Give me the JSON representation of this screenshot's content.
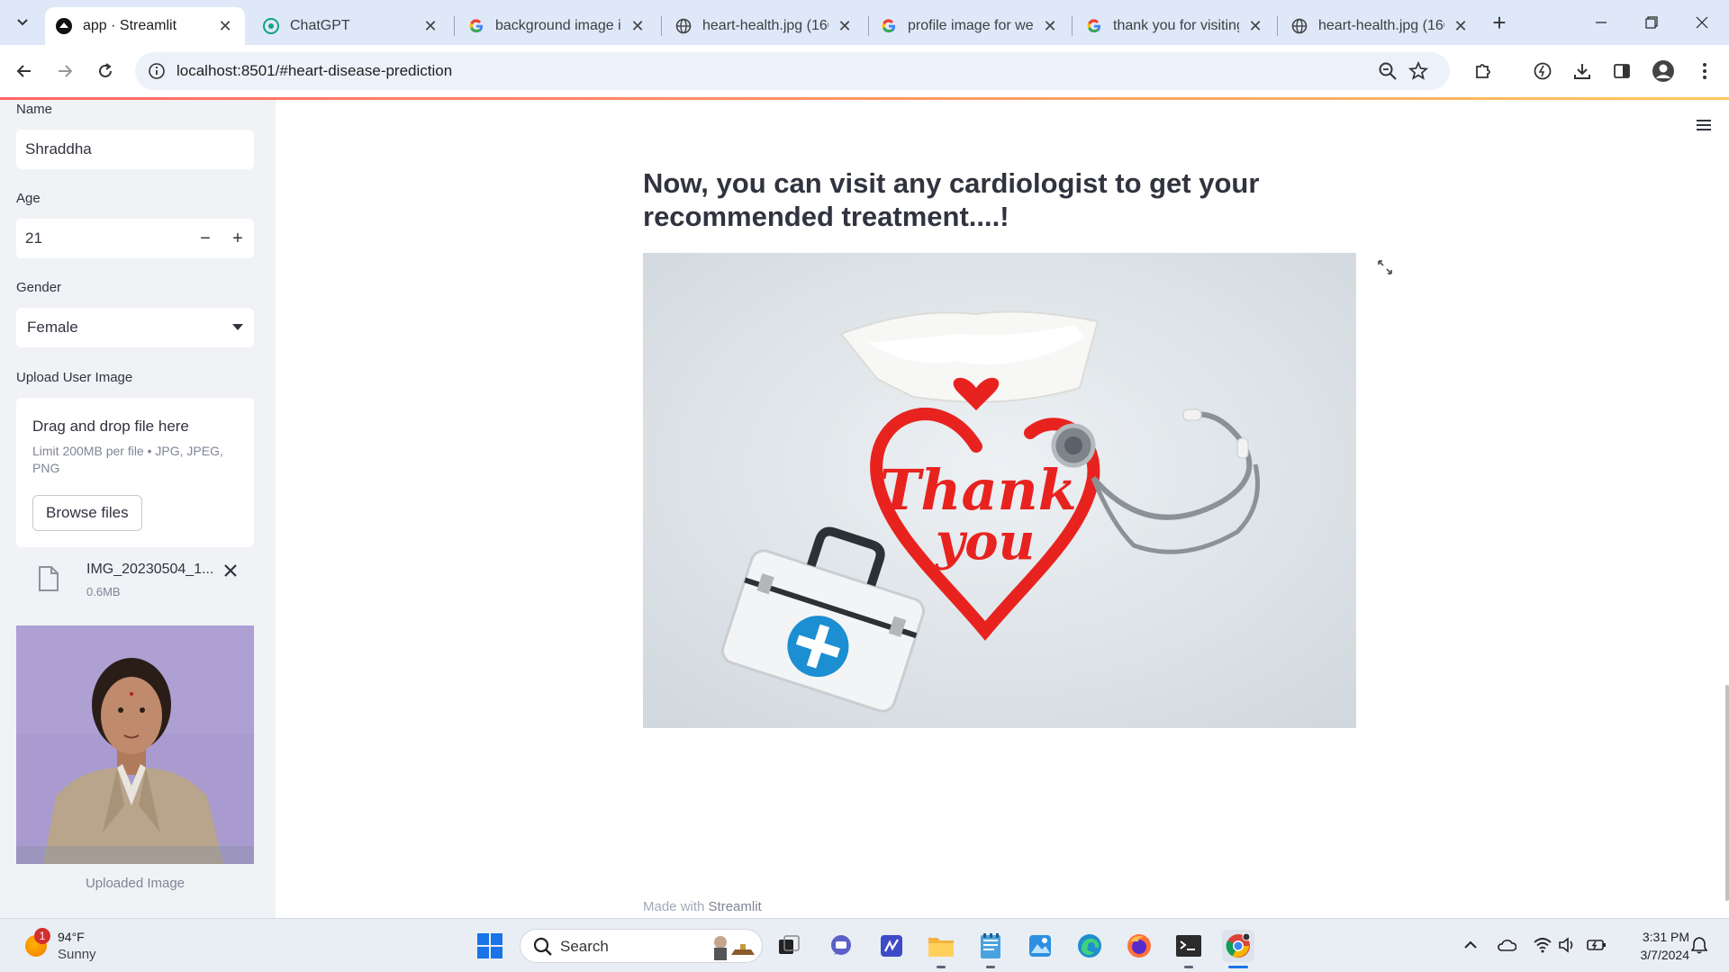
{
  "browser": {
    "tabs": [
      {
        "title": "app · Streamlit",
        "icon": "streamlit-icon",
        "active": true
      },
      {
        "title": "ChatGPT",
        "icon": "chatgpt-icon",
        "active": false
      },
      {
        "title": "background image in",
        "icon": "google-icon",
        "active": false
      },
      {
        "title": "heart-health.jpg (160",
        "icon": "globe-icon",
        "active": false
      },
      {
        "title": "profile image for wel",
        "icon": "google-icon",
        "active": false
      },
      {
        "title": "thank you for visiting",
        "icon": "google-icon",
        "active": false
      },
      {
        "title": "heart-health.jpg (160",
        "icon": "globe-icon",
        "active": false
      }
    ],
    "url": "localhost:8501/#heart-disease-prediction"
  },
  "sidebar": {
    "name_label": "Name",
    "name_value": "Shraddha",
    "age_label": "Age",
    "age_value": "21",
    "gender_label": "Gender",
    "gender_value": "Female",
    "upload_label": "Upload User Image",
    "drop_title": "Drag and drop file here",
    "drop_limit": "Limit 200MB per file • JPG, JPEG, PNG",
    "browse_label": "Browse files",
    "file_name": "IMG_20230504_1...",
    "file_size": "0.6MB",
    "photo_caption": "Uploaded Image"
  },
  "main": {
    "heading": "Now, you can visit any cardiologist to get your recommended treatment....!",
    "image_text": [
      "Thank",
      "you"
    ],
    "footer_prefix": "Made with ",
    "footer_brand": "Streamlit"
  },
  "taskbar": {
    "weather_badge": "1",
    "temperature": "94°F",
    "condition": "Sunny",
    "search_label": "Search",
    "time": "3:31 PM",
    "date": "3/7/2024"
  },
  "colors": {
    "accent": "#ff4b4b",
    "sidebar_bg": "#f0f2f6",
    "text": "#31333f",
    "heart_red": "#e8231f"
  }
}
